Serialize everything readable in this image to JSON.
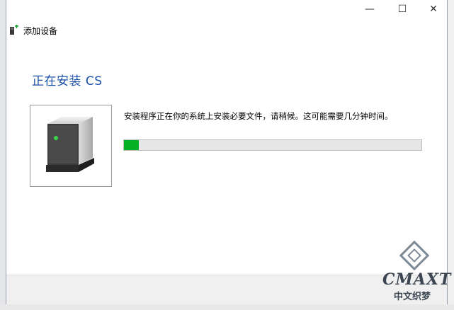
{
  "window": {
    "title": "添加设备",
    "controls": {
      "minimize": "—",
      "maximize": "☐",
      "close": "✕"
    }
  },
  "main": {
    "heading": "正在安装 CS",
    "message": "安装程序正在你的系统上安装必要文件，请稍候。这可能需要几分钟时间。",
    "progress_fraction": 0.05,
    "device_icon": "computer-tower-icon"
  },
  "watermark": {
    "text": "CMAXT",
    "sub": "中文织梦"
  },
  "colors": {
    "heading": "#1b4fa8",
    "progress_fill": "#06b025",
    "progress_track": "#e6e6e6"
  }
}
